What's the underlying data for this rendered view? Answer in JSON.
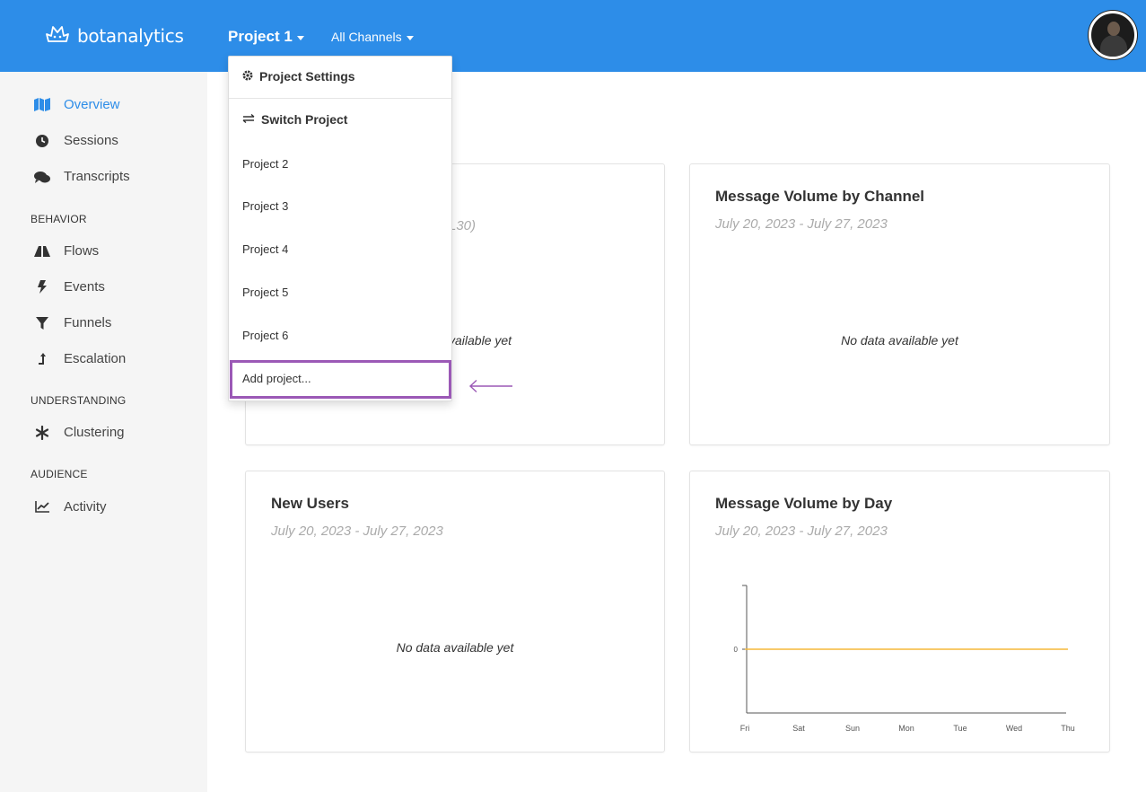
{
  "header": {
    "logo_text": "botanalytics",
    "project_label": "Project 1",
    "channels_label": "All Channels"
  },
  "sidebar": {
    "items_main": [
      {
        "label": "Overview",
        "icon": "map-icon"
      },
      {
        "label": "Sessions",
        "icon": "clock-icon"
      },
      {
        "label": "Transcripts",
        "icon": "comments-icon"
      }
    ],
    "behavior_heading": "BEHAVIOR",
    "items_behavior": [
      {
        "label": "Flows",
        "icon": "road-icon"
      },
      {
        "label": "Events",
        "icon": "bolt-icon"
      },
      {
        "label": "Funnels",
        "icon": "filter-icon"
      },
      {
        "label": "Escalation",
        "icon": "arrow-up-icon"
      }
    ],
    "understanding_heading": "UNDERSTANDING",
    "items_understanding": [
      {
        "label": "Clustering",
        "icon": "asterisk-icon"
      }
    ],
    "audience_heading": "AUDIENCE",
    "items_audience": [
      {
        "label": "Activity",
        "icon": "line-chart-icon"
      }
    ]
  },
  "dropdown": {
    "settings_label": "Project Settings",
    "switch_label": "Switch Project",
    "projects": [
      "Project 2",
      "Project 3",
      "Project 4",
      "Project 5",
      "Project 6"
    ],
    "add_label": "Add project..."
  },
  "cards": {
    "card1": {
      "range_partial": "L30)",
      "empty_partial": "vailable yet"
    },
    "channel": {
      "title": "Message Volume by Channel",
      "range": "July 20, 2023 - July 27, 2023",
      "empty": "No data available yet"
    },
    "users": {
      "title": "New Users",
      "range": "July 20, 2023 - July 27, 2023",
      "empty": "No data available yet"
    },
    "day": {
      "title": "Message Volume by Day",
      "range": "July 20, 2023 - July 27, 2023"
    }
  },
  "chart_data": {
    "type": "line",
    "categories": [
      "Fri",
      "Sat",
      "Sun",
      "Mon",
      "Tue",
      "Wed",
      "Thu"
    ],
    "series": [
      {
        "values": [
          0,
          0,
          0,
          0,
          0,
          0,
          0
        ],
        "color": "#f5b93a"
      }
    ],
    "yticks": [
      "0"
    ]
  },
  "colors": {
    "brand": "#2d8de8",
    "highlight": "#9b59b6",
    "series": "#f5b93a"
  }
}
